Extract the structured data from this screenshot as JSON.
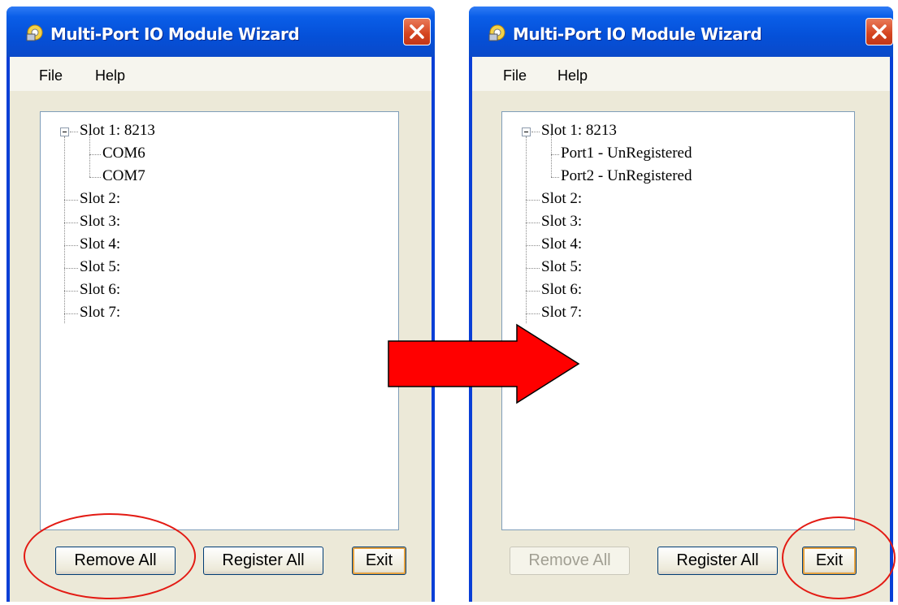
{
  "left_window": {
    "title": "Multi-Port IO Module Wizard",
    "menu": [
      "File",
      "Help"
    ],
    "tree": {
      "slot1": "Slot 1: 8213",
      "children": [
        "COM6",
        "COM7"
      ],
      "slots": [
        "Slot 2:",
        "Slot 3:",
        "Slot 4:",
        "Slot 5:",
        "Slot 6:",
        "Slot 7:"
      ]
    },
    "buttons": {
      "remove_all": "Remove All",
      "register_all": "Register All",
      "exit": "Exit"
    }
  },
  "right_window": {
    "title": "Multi-Port IO Module Wizard",
    "menu": [
      "File",
      "Help"
    ],
    "tree": {
      "slot1": "Slot 1: 8213",
      "children": [
        "Port1 - UnRegistered",
        "Port2 - UnRegistered"
      ],
      "slots": [
        "Slot 2:",
        "Slot 3:",
        "Slot 4:",
        "Slot 5:",
        "Slot 6:",
        "Slot 7:"
      ]
    },
    "buttons": {
      "remove_all": "Remove All",
      "register_all": "Register All",
      "exit": "Exit"
    }
  },
  "colors": {
    "arrow": "#ff0000",
    "highlight_ellipse": "#e31b14",
    "titlebar": "#0550d8"
  },
  "icons": {
    "window_icon": "wizard-app-icon",
    "close": "close-icon",
    "transition": "right-arrow-icon",
    "tree_toggle": "collapse-minus-icon"
  }
}
